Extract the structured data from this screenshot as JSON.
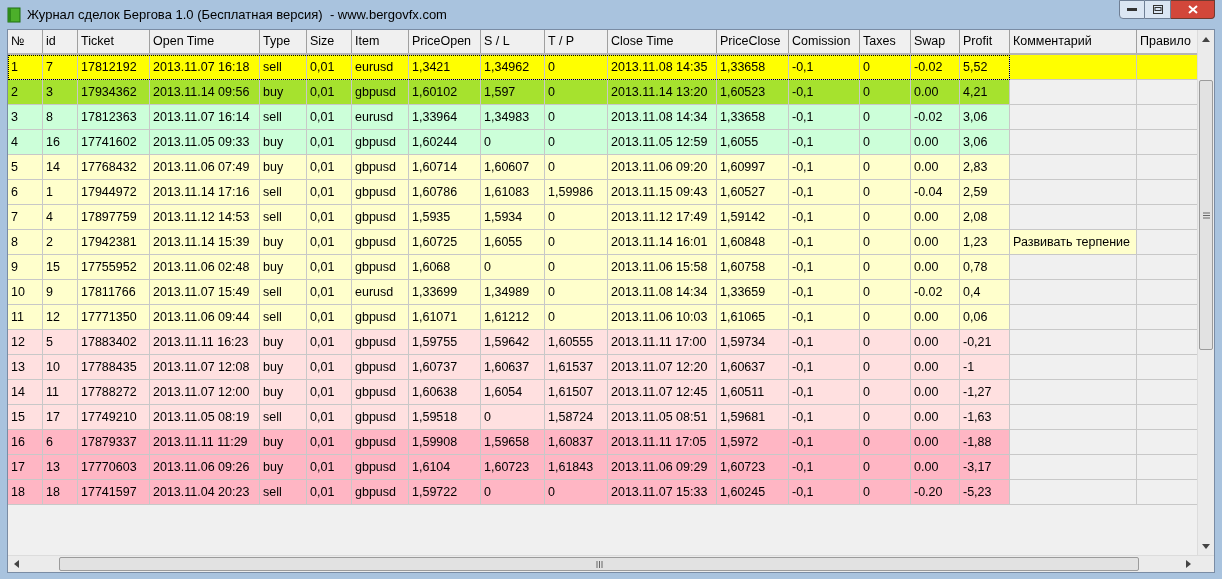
{
  "window": {
    "title": "Журнал сделок Бергова 1.0 (Бесплатная версия)  - www.bergovfx.com"
  },
  "table": {
    "columns": [
      "№",
      "id",
      "Ticket",
      "Open Time",
      "Type",
      "Size",
      "Item",
      "PriceOpen",
      "S / L",
      "T / P",
      "Close Time",
      "PriceClose",
      "Comission",
      "Taxes",
      "Swap",
      "Profit",
      "Комментарий",
      "Правило"
    ],
    "rows": [
      {
        "selected": true,
        "color": "#ffff00",
        "cells": [
          "1",
          "7",
          "17812192",
          "2013.11.07 16:18",
          "sell",
          "0,01",
          "eurusd",
          "1,3421",
          "1,34962",
          "0",
          "2013.11.08 14:35",
          "1,33658",
          "-0,1",
          "0",
          "-0.02",
          "5,52"
        ]
      },
      {
        "selected": false,
        "color": "#a6e22e",
        "cells": [
          "2",
          "3",
          "17934362",
          "2013.11.14 09:56",
          "buy",
          "0,01",
          "gbpusd",
          "1,60102",
          "1,597",
          "0",
          "2013.11.14 13:20",
          "1,60523",
          "-0,1",
          "0",
          "0.00",
          "4,21"
        ]
      },
      {
        "selected": false,
        "color": "#ccffd9",
        "cells": [
          "3",
          "8",
          "17812363",
          "2013.11.07 16:14",
          "sell",
          "0,01",
          "eurusd",
          "1,33964",
          "1,34983",
          "0",
          "2013.11.08 14:34",
          "1,33658",
          "-0,1",
          "0",
          "-0.02",
          "3,06"
        ]
      },
      {
        "selected": false,
        "color": "#ccffd9",
        "cells": [
          "4",
          "16",
          "17741602",
          "2013.11.05 09:33",
          "buy",
          "0,01",
          "gbpusd",
          "1,60244",
          "0",
          "0",
          "2013.11.05 12:59",
          "1,6055",
          "-0,1",
          "0",
          "0.00",
          "3,06"
        ]
      },
      {
        "selected": false,
        "color": "#ffffcc",
        "cells": [
          "5",
          "14",
          "17768432",
          "2013.11.06 07:49",
          "buy",
          "0,01",
          "gbpusd",
          "1,60714",
          "1,60607",
          "0",
          "2013.11.06 09:20",
          "1,60997",
          "-0,1",
          "0",
          "0.00",
          "2,83"
        ]
      },
      {
        "selected": false,
        "color": "#ffffcc",
        "cells": [
          "6",
          "1",
          "17944972",
          "2013.11.14 17:16",
          "sell",
          "0,01",
          "gbpusd",
          "1,60786",
          "1,61083",
          "1,59986",
          "2013.11.15 09:43",
          "1,60527",
          "-0,1",
          "0",
          "-0.04",
          "2,59"
        ]
      },
      {
        "selected": false,
        "color": "#ffffcc",
        "cells": [
          "7",
          "4",
          "17897759",
          "2013.11.12 14:53",
          "sell",
          "0,01",
          "gbpusd",
          "1,5935",
          "1,5934",
          "0",
          "2013.11.12 17:49",
          "1,59142",
          "-0,1",
          "0",
          "0.00",
          "2,08"
        ]
      },
      {
        "selected": false,
        "color": "#ffffcc",
        "comment": "Развивать терпение",
        "cells": [
          "8",
          "2",
          "17942381",
          "2013.11.14 15:39",
          "buy",
          "0,01",
          "gbpusd",
          "1,60725",
          "1,6055",
          "0",
          "2013.11.14 16:01",
          "1,60848",
          "-0,1",
          "0",
          "0.00",
          "1,23"
        ]
      },
      {
        "selected": false,
        "color": "#ffffcc",
        "cells": [
          "9",
          "15",
          "17755952",
          "2013.11.06 02:48",
          "buy",
          "0,01",
          "gbpusd",
          "1,6068",
          "0",
          "0",
          "2013.11.06 15:58",
          "1,60758",
          "-0,1",
          "0",
          "0.00",
          "0,78"
        ]
      },
      {
        "selected": false,
        "color": "#ffffcc",
        "cells": [
          "10",
          "9",
          "17811766",
          "2013.11.07 15:49",
          "sell",
          "0,01",
          "eurusd",
          "1,33699",
          "1,34989",
          "0",
          "2013.11.08 14:34",
          "1,33659",
          "-0,1",
          "0",
          "-0.02",
          "0,4"
        ]
      },
      {
        "selected": false,
        "color": "#ffffcc",
        "cells": [
          "11",
          "12",
          "17771350",
          "2013.11.06 09:44",
          "sell",
          "0,01",
          "gbpusd",
          "1,61071",
          "1,61212",
          "0",
          "2013.11.06 10:03",
          "1,61065",
          "-0,1",
          "0",
          "0.00",
          "0,06"
        ]
      },
      {
        "selected": false,
        "color": "#ffe0e0",
        "cells": [
          "12",
          "5",
          "17883402",
          "2013.11.11 16:23",
          "buy",
          "0,01",
          "gbpusd",
          "1,59755",
          "1,59642",
          "1,60555",
          "2013.11.11 17:00",
          "1,59734",
          "-0,1",
          "0",
          "0.00",
          "-0,21"
        ]
      },
      {
        "selected": false,
        "color": "#ffe0e0",
        "cells": [
          "13",
          "10",
          "17788435",
          "2013.11.07 12:08",
          "buy",
          "0,01",
          "gbpusd",
          "1,60737",
          "1,60637",
          "1,61537",
          "2013.11.07 12:20",
          "1,60637",
          "-0,1",
          "0",
          "0.00",
          "-1"
        ]
      },
      {
        "selected": false,
        "color": "#ffe0e0",
        "cells": [
          "14",
          "11",
          "17788272",
          "2013.11.07 12:00",
          "buy",
          "0,01",
          "gbpusd",
          "1,60638",
          "1,6054",
          "1,61507",
          "2013.11.07 12:45",
          "1,60511",
          "-0,1",
          "0",
          "0.00",
          "-1,27"
        ]
      },
      {
        "selected": false,
        "color": "#ffe0e0",
        "cells": [
          "15",
          "17",
          "17749210",
          "2013.11.05 08:19",
          "sell",
          "0,01",
          "gbpusd",
          "1,59518",
          "0",
          "1,58724",
          "2013.11.05 08:51",
          "1,59681",
          "-0,1",
          "0",
          "0.00",
          "-1,63"
        ]
      },
      {
        "selected": false,
        "color": "#ffb6c4",
        "cells": [
          "16",
          "6",
          "17879337",
          "2013.11.11 11:29",
          "buy",
          "0,01",
          "gbpusd",
          "1,59908",
          "1,59658",
          "1,60837",
          "2013.11.11 17:05",
          "1,5972",
          "-0,1",
          "0",
          "0.00",
          "-1,88"
        ]
      },
      {
        "selected": false,
        "color": "#ffb6c4",
        "cells": [
          "17",
          "13",
          "17770603",
          "2013.11.06 09:26",
          "buy",
          "0,01",
          "gbpusd",
          "1,6104",
          "1,60723",
          "1,61843",
          "2013.11.06 09:29",
          "1,60723",
          "-0,1",
          "0",
          "0.00",
          "-3,17"
        ]
      },
      {
        "selected": false,
        "color": "#ffb6c4",
        "cells": [
          "18",
          "18",
          "17741597",
          "2013.11.04 20:23",
          "sell",
          "0,01",
          "gbpusd",
          "1,59722",
          "0",
          "0",
          "2013.11.07 15:33",
          "1,60245",
          "-0,1",
          "0",
          "-0.20",
          "-5,23"
        ]
      }
    ]
  }
}
